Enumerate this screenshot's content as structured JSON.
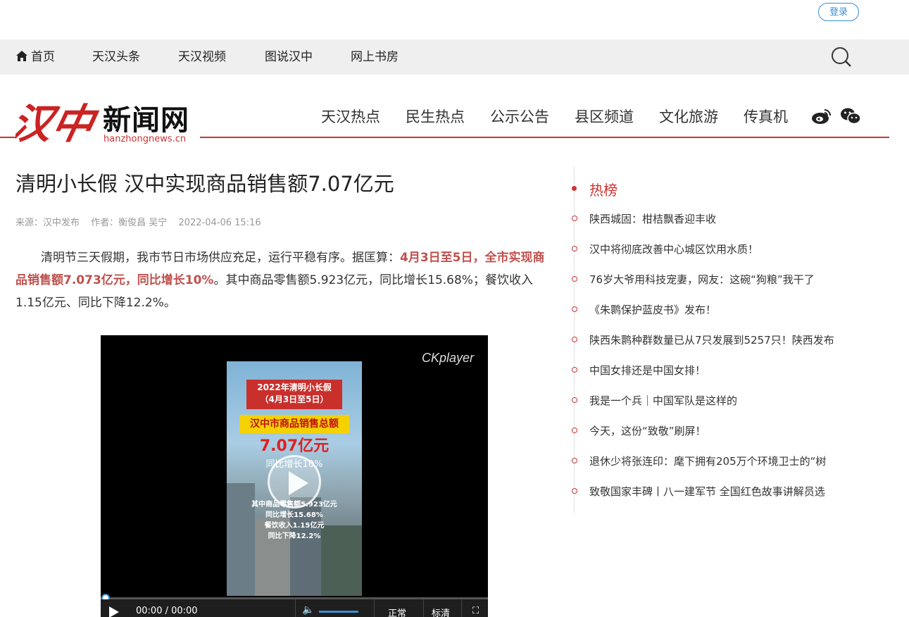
{
  "header": {
    "login_label": "登录",
    "nav": [
      "首页",
      "天汉头条",
      "天汉视频",
      "图说汉中",
      "网上书房"
    ]
  },
  "brand": {
    "logo_calligraphy": "汉中",
    "logo_text": "新闻网",
    "logo_url": "hanzhongnews.cn",
    "channels": [
      "天汉热点",
      "民生热点",
      "公示公告",
      "县区频道",
      "文化旅游",
      "传真机"
    ]
  },
  "article": {
    "title": "清明小长假 汉中实现商品销售额7.07亿元",
    "source": "来源：汉中发布",
    "author": "作者：衡俊昌 吴宁",
    "date": "2022-04-06 15:16",
    "body_1": "清明节三天假期，我市节日市场供应充足，运行平稳有序。据匡算：",
    "body_hl": "4月3日至5日，全市实现商品销售额7.073亿元，同比增长10%",
    "body_2": "。其中商品零售额5.923亿元，同比增长15.68%；餐饮收入1.15亿元、同比下降12.2%。"
  },
  "video": {
    "player_label": "CKplayer",
    "poster_title_1": "2022年清明小长假",
    "poster_title_2": "（4月3日至5日）",
    "poster_band": "汉中市商品销售总额",
    "poster_big": "7.07亿元",
    "poster_growth": "同比增长10%",
    "poster_line_1": "其中商品零售额5.923亿元",
    "poster_line_2": "同比增长15.68%",
    "poster_line_3": "餐饮收入1.15亿元",
    "poster_line_4": "同比下降12.2%",
    "time": "00:00 / 00:00",
    "btn_1": "正常",
    "btn_2": "标清",
    "progress": 0
  },
  "sidebar": {
    "title": "热榜",
    "items": [
      "陕西城固：柑桔飘香迎丰收",
      "汉中将彻底改善中心城区饮用水质！",
      "76岁大爷用科技宠妻，网友：这碗“狗粮”我干了",
      "《朱鹮保护蓝皮书》发布！",
      "陕西朱鹮种群数量已从7只发展到5257只！陕西发布",
      "中国女排还是中国女排！",
      "我是一个兵｜中国军队是这样的",
      "今天，这份“致敬”刷屏！",
      "退休少将张连印：麾下拥有205万个环境卫士的“树",
      "致敬国家丰碑丨八一建军节 全国红色故事讲解员选"
    ]
  },
  "colors": {
    "brand_red": "#cc3333",
    "link_blue": "#3a8fd1",
    "highlight": "#c0504d"
  }
}
